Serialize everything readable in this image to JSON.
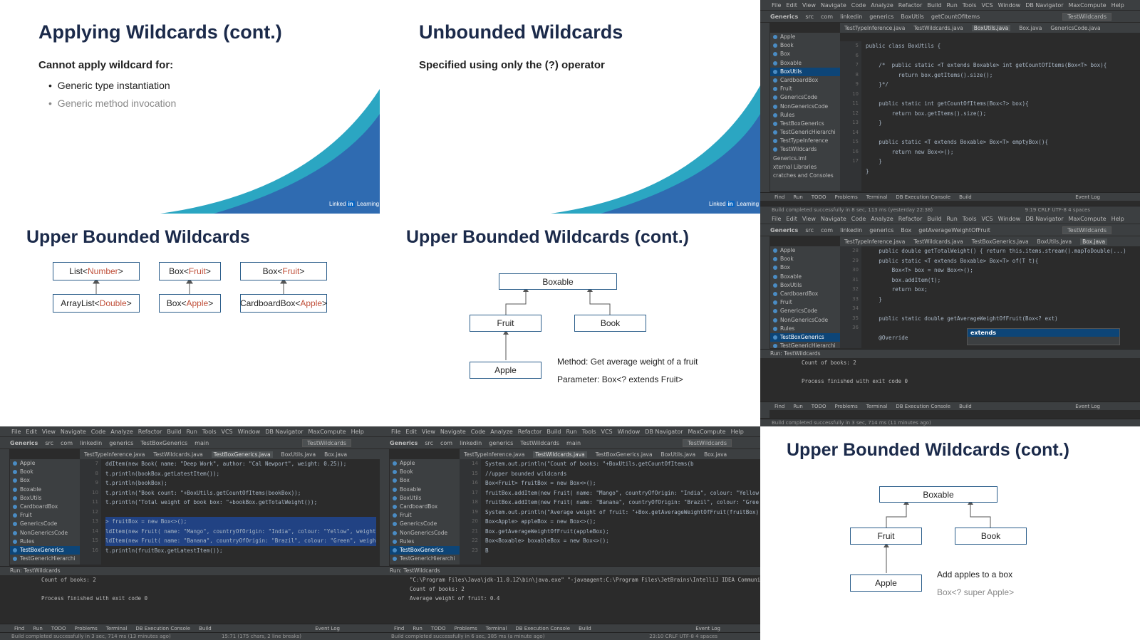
{
  "slides": {
    "s1": {
      "title": "Applying Wildcards (cont.)",
      "subtitle": "Cannot apply wildcard for:",
      "bullets": [
        "Generic type instantiation",
        "Generic method invocation"
      ],
      "brand": "Learning"
    },
    "s2": {
      "title": "Unbounded Wildcards",
      "subtitle": "Specified using only the (?) operator",
      "brand": "Learning"
    },
    "s3": {
      "title": "Upper Bounded Wildcards",
      "pairs": [
        {
          "top_base": "List",
          "top_arg": "Number",
          "bottom_base": "ArrayList",
          "bottom_arg": "Double"
        },
        {
          "top_base": "Box",
          "top_arg": "Fruit",
          "bottom_base": "Box",
          "bottom_arg": "Apple"
        },
        {
          "top_base": "Box",
          "top_arg": "Fruit",
          "bottom_base": "CardboardBox",
          "bottom_arg": "Apple"
        }
      ]
    },
    "s4": {
      "title": "Upper Bounded Wildcards (cont.)",
      "nodes": {
        "root": "Boxable",
        "left": "Fruit",
        "right": "Book",
        "child": "Apple"
      },
      "note1": "Method: Get average weight of a fruit",
      "note2": "Parameter: Box<? extends Fruit>"
    },
    "s6": {
      "title": "Upper Bounded Wildcards (cont.)",
      "nodes": {
        "root": "Boxable",
        "left": "Fruit",
        "right": "Book",
        "child": "Apple"
      },
      "note1": "Add apples to a box",
      "note2": "Box<? super Apple>"
    }
  },
  "ide": {
    "menu": [
      "File",
      "Edit",
      "View",
      "Navigate",
      "Code",
      "Analyze",
      "Refactor",
      "Build",
      "Run",
      "Tools",
      "VCS",
      "Window",
      "DB Navigator",
      "MaxCompute",
      "Help"
    ],
    "run_config": "TestWildcards",
    "tree_items": [
      "Apple",
      "Book",
      "Box",
      "Boxable",
      "BoxUtils",
      "CardboardBox",
      "Fruit",
      "GenericsCode",
      "NonGenericsCode",
      "Rules",
      "TestBoxGenerics",
      "TestGenericHierarchi",
      "TestTypeInference",
      "TestWildcards"
    ],
    "bottom_tabs": [
      "Find",
      "Run",
      "TODO",
      "Problems",
      "Terminal",
      "DB Execution Console",
      "Build"
    ],
    "event_log": "Event Log",
    "w1": {
      "crumbs": [
        "Generics",
        "src",
        "com",
        "linkedin",
        "generics",
        "BoxUtils",
        "getCountOfItems"
      ],
      "tabs": [
        "TestTypeInference.java",
        "TestWildcards.java",
        "BoxUtils.java",
        "Box.java",
        "GenericsCode.java"
      ],
      "lines": [
        "5",
        "6",
        "7",
        "8",
        "9",
        "10",
        "11",
        "12",
        "13",
        "14",
        "15",
        "16",
        "17"
      ],
      "code": [
        "public class BoxUtils {",
        "",
        "    /*  public static <T extends Boxable> int getCountOfItems(Box<T> box){",
        "          return box.getItems().size();",
        "    }*/",
        "",
        "    public static int getCountOfItems(Box<?> box){",
        "        return box.getItems().size();",
        "    }",
        "",
        "    public static <T extends Boxable> Box<T> emptyBox(){",
        "        return new Box<>();",
        "    }",
        "}"
      ],
      "extra_tree": [
        "Generics.iml",
        "xternal Libraries",
        "cratches and Consoles"
      ],
      "status": "Build completed successfully in 8 sec, 113 ms (yesterday 22:38)",
      "pos": "9:19  CRLF  UTF-8  4 spaces"
    },
    "w2": {
      "crumbs": [
        "Generics",
        "src",
        "com",
        "linkedin",
        "generics",
        "Box",
        "getAverageWeightOfFruit"
      ],
      "tabs": [
        "TestTypeInference.java",
        "TestWildcards.java",
        "TestBoxGenerics.java",
        "BoxUtils.java",
        "Box.java"
      ],
      "lines": [
        "28",
        "29",
        "30",
        "31",
        "32",
        "33",
        "34",
        "35",
        "36"
      ],
      "code": [
        "    public double getTotalWeight() { return this.items.stream().mapToDouble(...)",
        "    public static <T extends Boxable> Box<T> of(T t){",
        "        Box<T> box = new Box<>();",
        "        box.addItem(t);",
        "        return box;",
        "    }",
        "",
        "    public static double getAverageWeightOfFruit(Box<? ext)",
        "",
        "    @Override"
      ],
      "completion": "extends",
      "run_title": "TestWildcards",
      "run_lines": [
        "Count of books: 2",
        "",
        "Process finished with exit code 0"
      ],
      "status": "Build completed successfully in 3 sec, 714 ms (11 minutes ago)"
    },
    "w3": {
      "crumbs": [
        "Generics",
        "src",
        "com",
        "linkedin",
        "generics",
        "TestBoxGenerics",
        "main"
      ],
      "tabs": [
        "TestTypeInference.java",
        "TestWildcards.java",
        "TestBoxGenerics.java",
        "BoxUtils.java",
        "Box.java"
      ],
      "lines": [
        "7",
        "8",
        "9",
        "10",
        "11",
        "12",
        "13",
        "14",
        "15",
        "16"
      ],
      "code": [
        "ddItem(new Book( name: \"Deep Work\", author: \"Cal Newport\", weight: 0.25));",
        "t.println(bookBox.getLatestItem());",
        "t.println(bookBox);",
        "t.println(\"Book count: \"+BoxUtils.getCountOfItems(bookBox));",
        "t.println(\"Total weight of book box: \"+bookBox.getTotalWeight());",
        "",
        "> fruitBox = new Box<>();",
        "ldItem(new Fruit( name: \"Mango\", countryOfOrigin: \"India\", colour: \"Yellow\", weight: 0.5));",
        "ldItem(new Fruit( name: \"Banana\", countryOfOrigin: \"Brazil\", colour: \"Green\", weight: 0.3));",
        "t.println(fruitBox.getLatestItem());"
      ],
      "run_title": "TestWildcards",
      "run_lines": [
        "Count of books: 2",
        "",
        "Process finished with exit code 0"
      ],
      "status": "Build completed successfully in 3 sec, 714 ms (13 minutes ago)",
      "pos": "15:71 (175 chars, 2 line breaks)"
    },
    "w4": {
      "crumbs": [
        "Generics",
        "src",
        "com",
        "linkedin",
        "generics",
        "TestWildcards",
        "main"
      ],
      "tabs": [
        "TestTypeInference.java",
        "TestWildcards.java",
        "TestBoxGenerics.java",
        "BoxUtils.java",
        "Box.java"
      ],
      "lines": [
        "14",
        "15",
        "16",
        "17",
        "18",
        "19",
        "20",
        "21",
        "22",
        "23"
      ],
      "code": [
        "System.out.println(\"Count of books: \"+BoxUtils.getCountOfItems(b",
        "//upper bounded wildcards",
        "Box<Fruit> fruitBox = new Box<>();",
        "fruitBox.addItem(new Fruit( name: \"Mango\", countryOfOrigin: \"India\", colour: \"Yellow\", weight: 0",
        "fruitBox.addItem(new Fruit( name: \"Banana\", countryOfOrigin: \"Brazil\", colour: \"Green\", weight: 0",
        "System.out.println(\"Average weight of fruit: \"+Box.getAverageWeightOfFruit(fruitBox));",
        "Box<Apple> appleBox = new Box<>();",
        "Box.getAverageWeightOfFruit(appleBox);",
        "Box<Boxable> boxableBox = new Box<>();",
        "B"
      ],
      "run_title": "TestWildcards",
      "run_lines": [
        "\"C:\\Program Files\\Java\\jdk-11.0.12\\bin\\java.exe\" \"-javaagent:C:\\Program Files\\JetBrains\\IntelliJ IDEA Community Edition 2019.2\\li",
        "Count of books: 2",
        "Average weight of fruit: 0.4"
      ],
      "status": "Build completed successfully in 6 sec, 385 ms (a minute ago)",
      "pos": "23:10  CRLF  UTF-8  4 spaces"
    }
  },
  "colors": {
    "title": "#1b2a4a",
    "accent": "#2a5d8a",
    "wave_dark": "#2f6bb1",
    "wave_light": "#2ba6c2",
    "ide_bg": "#2b2b2b"
  }
}
